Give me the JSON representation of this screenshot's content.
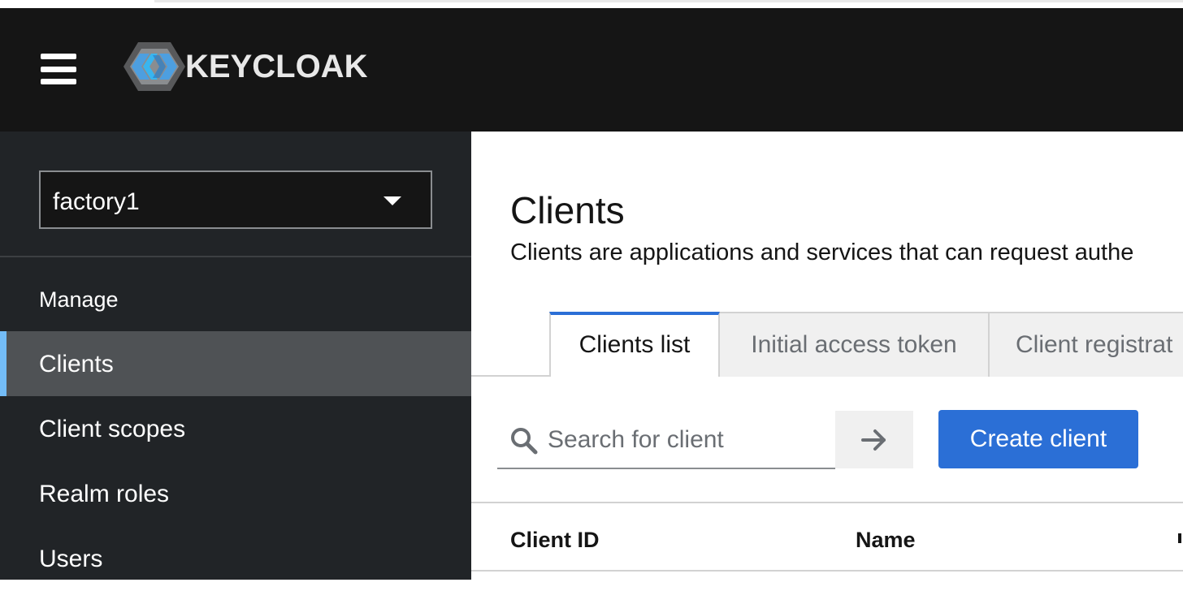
{
  "header": {
    "brand": "KEYCLOAK",
    "menu_icon": "hamburger-menu-icon",
    "logo_icon": "keycloak-logo-icon",
    "colors": {
      "background": "#151515",
      "logo_blue": "#4d9fe0",
      "logo_gray": "#8a8d90"
    }
  },
  "sidebar": {
    "realm": "factory1",
    "section_title": "Manage",
    "items": [
      {
        "label": "Clients",
        "active": true
      },
      {
        "label": "Client scopes",
        "active": false
      },
      {
        "label": "Realm roles",
        "active": false
      },
      {
        "label": "Users",
        "active": false
      }
    ],
    "colors": {
      "background": "#212427",
      "active_bg": "#4f5255",
      "active_indicator": "#73bcf7"
    }
  },
  "main": {
    "title": "Clients",
    "description": "Clients are applications and services that can request authe",
    "tabs": [
      {
        "label": "Clients list",
        "active": true
      },
      {
        "label": "Initial access token",
        "active": false
      },
      {
        "label": "Client registrat",
        "active": false
      }
    ],
    "search": {
      "placeholder": "Search for client",
      "value": "",
      "icon": "search-icon",
      "submit_icon": "arrow-right-icon"
    },
    "create_button": "Create client",
    "table": {
      "columns": [
        "Client ID",
        "Name"
      ]
    },
    "colors": {
      "primary": "#2b6fd6"
    }
  }
}
